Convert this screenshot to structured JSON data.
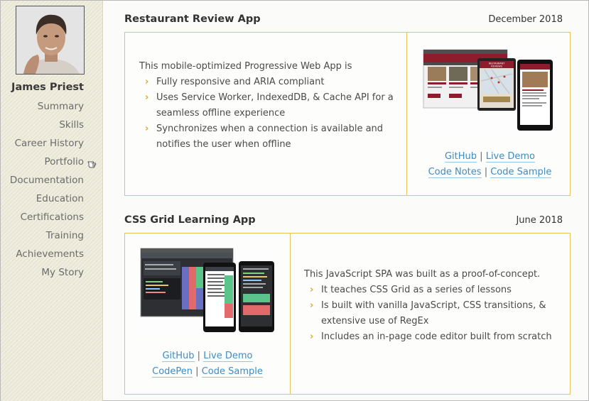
{
  "profile": {
    "name": "James Priest"
  },
  "nav": {
    "items": [
      {
        "label": "Summary"
      },
      {
        "label": "Skills"
      },
      {
        "label": "Career History"
      },
      {
        "label": "Portfolio"
      },
      {
        "label": "Documentation"
      },
      {
        "label": "Education"
      },
      {
        "label": "Certifications"
      },
      {
        "label": "Training"
      },
      {
        "label": "Achievements"
      },
      {
        "label": "My Story"
      }
    ],
    "active_icon": "hand-pointer-icon"
  },
  "projects": [
    {
      "title": "Restaurant Review App",
      "date": "December 2018",
      "intro": "This mobile-optimized Progressive Web App is",
      "bullets": [
        "Fully responsive and ARIA compliant",
        "Uses Service Worker, IndexedDB, & Cache API for a seamless offline experience",
        "Synchronizes when a connection is available and notifies the user when offline"
      ],
      "links": [
        "GitHub",
        "Live Demo",
        "Code Notes",
        "Code Sample"
      ],
      "screenshot": {
        "brand_lines": [
          "RESTAURANT",
          "REVIEWS"
        ]
      }
    },
    {
      "title": "CSS Grid Learning App",
      "date": "June 2018",
      "intro": "This JavaScript SPA was built as a proof-of-concept.",
      "bullets": [
        "It teaches CSS Grid as a series of lessons",
        "Is built with vanilla JavaScript, CSS transitions, & extensive use of RegEx",
        "Includes an in-page code editor built from scratch"
      ],
      "links": [
        "GitHub",
        "Live Demo",
        "CodePen",
        "Code Sample"
      ]
    }
  ],
  "colors": {
    "accent": "#e5c45d",
    "chevron": "#e1a623",
    "link": "#3e8cc4",
    "sidebar_bg": "#e9e5d3"
  }
}
